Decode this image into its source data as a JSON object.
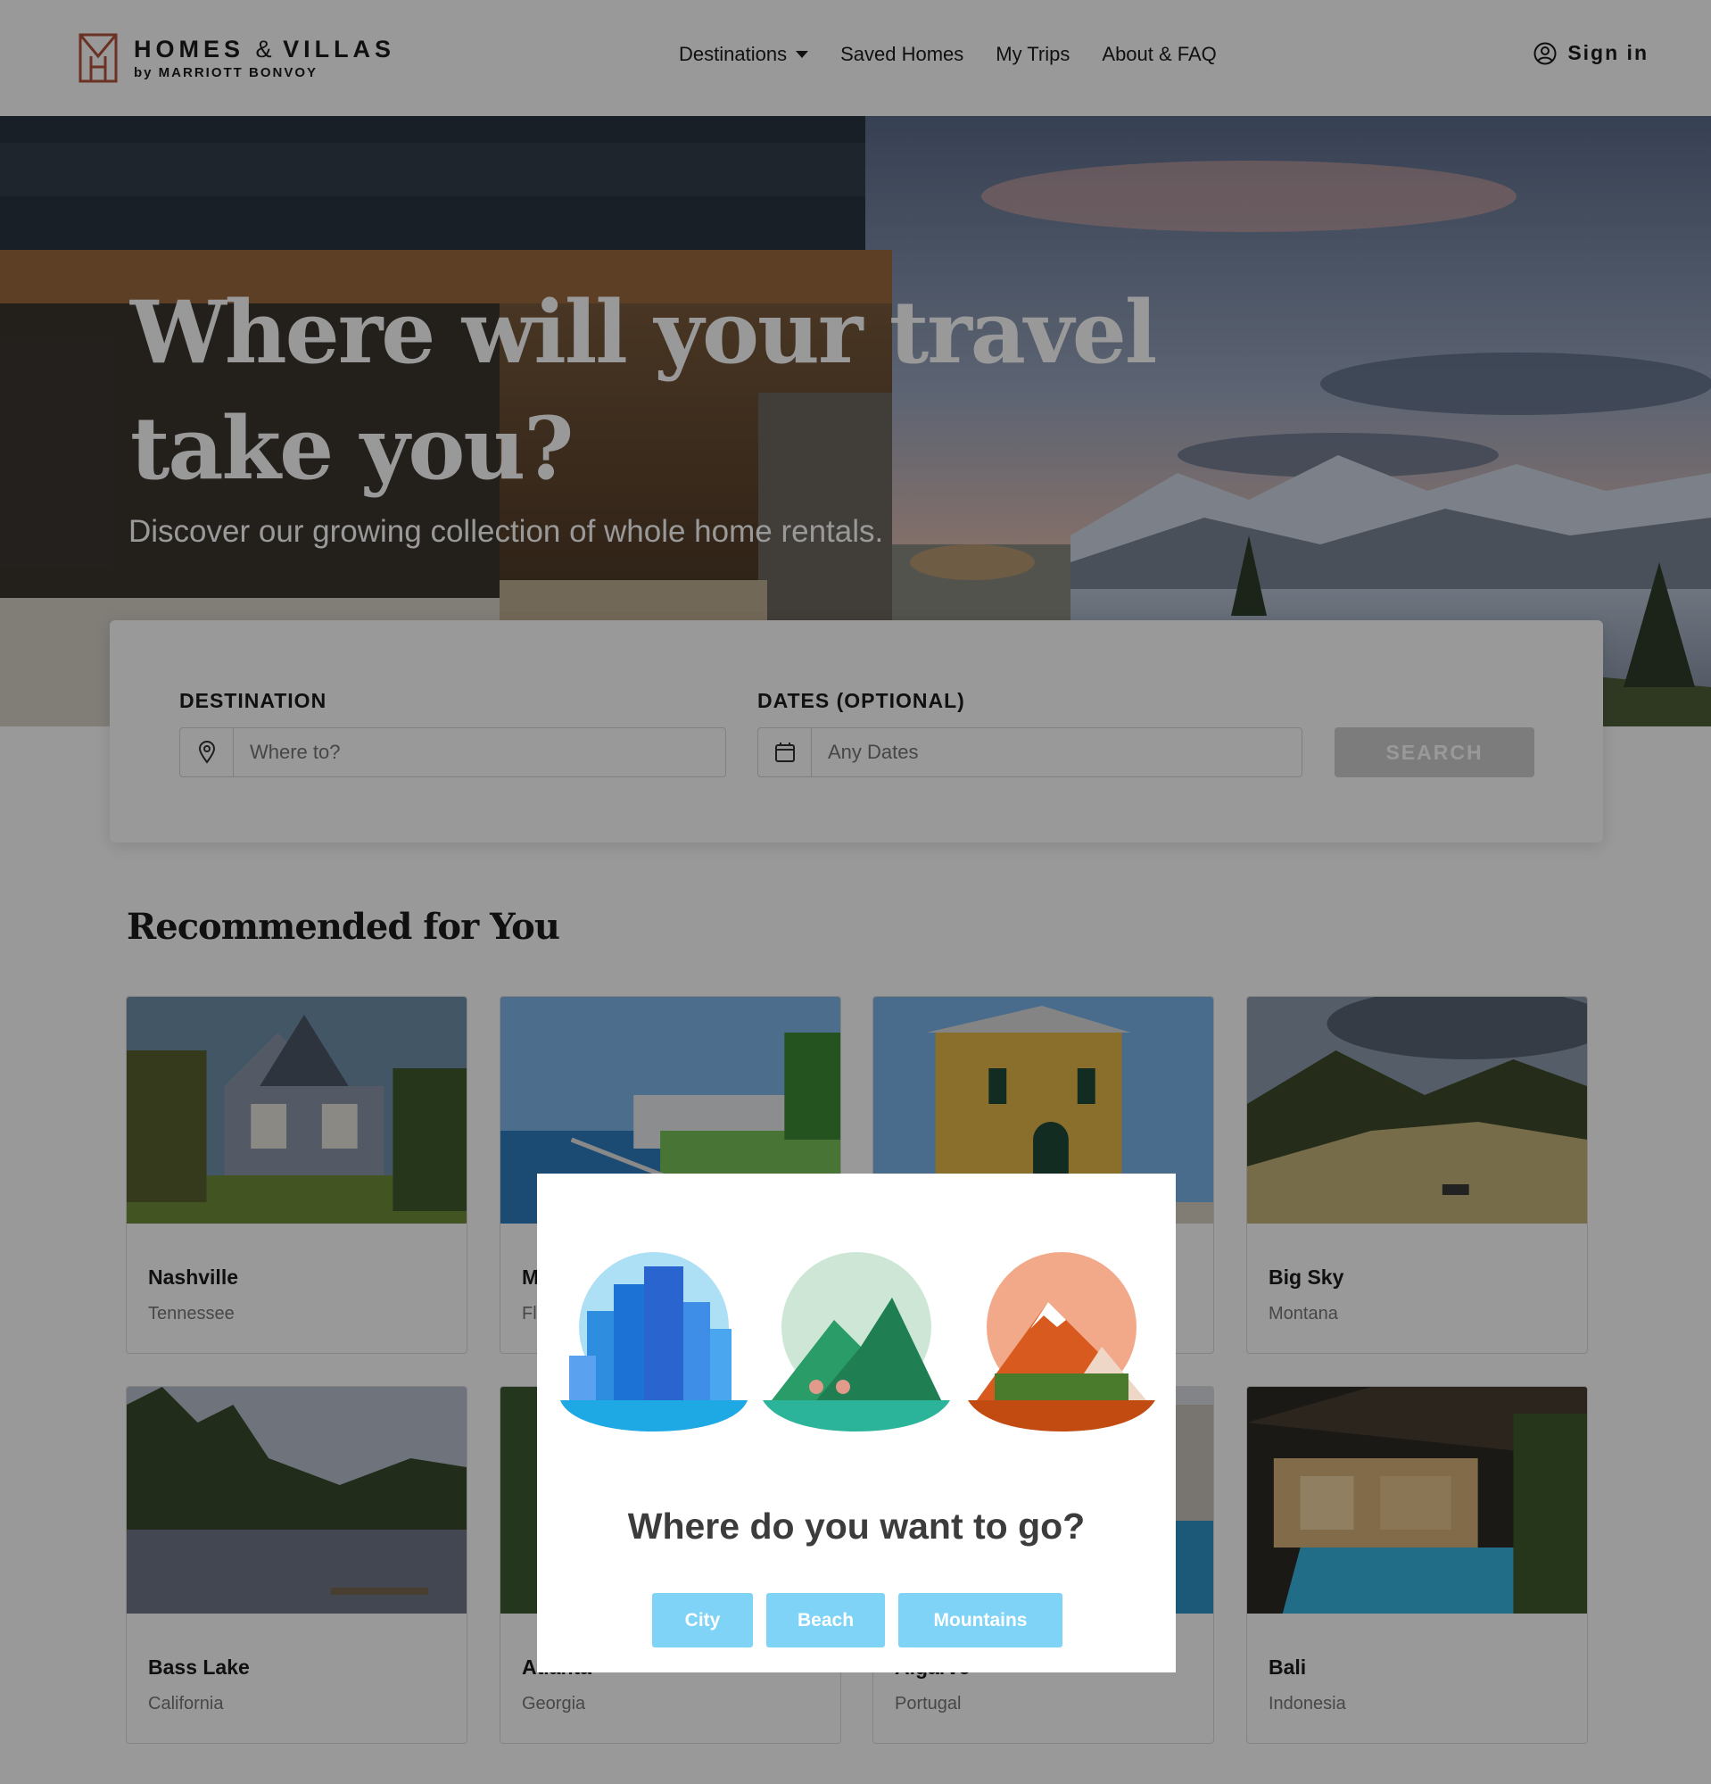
{
  "brand": {
    "name_homes": "HOMES",
    "name_amp": "&",
    "name_villas": "VILLAS",
    "byline": "by MARRIOTT BONVOY",
    "accent_color": "#b3543c"
  },
  "nav": {
    "items": [
      {
        "label": "Destinations",
        "has_dropdown": true
      },
      {
        "label": "Saved Homes"
      },
      {
        "label": "My Trips"
      },
      {
        "label": "About & FAQ"
      }
    ],
    "sign_in": "Sign in"
  },
  "hero": {
    "title_line1": "Where will your travel",
    "title_line2": "take you?",
    "subtitle": "Discover our growing collection of whole home rentals."
  },
  "search": {
    "destination_label": "DESTINATION",
    "destination_placeholder": "Where to?",
    "dates_label": "DATES (OPTIONAL)",
    "dates_placeholder": "Any Dates",
    "button_label": "SEARCH"
  },
  "recommended": {
    "title": "Recommended for You",
    "cards": [
      {
        "city": "Nashville",
        "region": "Tennessee"
      },
      {
        "city": "M",
        "region": "Fl"
      },
      {
        "city": "",
        "region": ""
      },
      {
        "city": "Big Sky",
        "region": "Montana"
      },
      {
        "city": "Bass Lake",
        "region": "California"
      },
      {
        "city": "Atlanta",
        "region": "Georgia"
      },
      {
        "city": "Algarve",
        "region": "Portugal"
      },
      {
        "city": "Bali",
        "region": "Indonesia"
      }
    ]
  },
  "modal": {
    "question": "Where do you want to go?",
    "options": [
      "City",
      "Beach",
      "Mountains"
    ],
    "button_color": "#7fd3f7"
  }
}
